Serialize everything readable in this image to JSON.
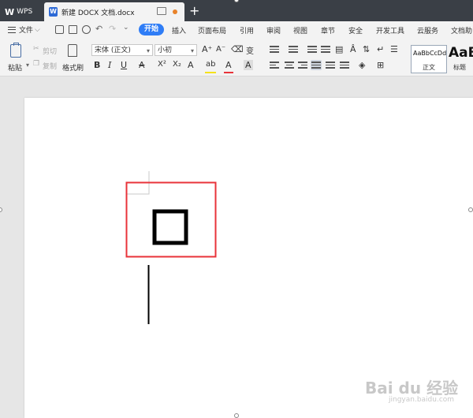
{
  "titlebar": {
    "app_tab_label": "WPS",
    "doc_tab_title": "新建 DOCX 文档.docx",
    "new_tab_symbol": "+"
  },
  "menubar": {
    "file_label": "文件",
    "active_tab": "开始",
    "items": [
      "插入",
      "页面布局",
      "引用",
      "审阅",
      "视图",
      "章节",
      "安全",
      "开发工具",
      "云服务",
      "文档助"
    ]
  },
  "ribbon": {
    "paste_label": "粘贴",
    "cut_label": "剪切",
    "copy_label": "复制",
    "format_painter_label": "格式刷",
    "font_name": "宋体 (正文)",
    "font_size": "小初",
    "style_normal_sample": "AaBbCcDd",
    "style_normal_label": "正文",
    "style_heading_sample": "AaB",
    "style_heading_label": "标题"
  },
  "colors": {
    "accent": "#2f7df6",
    "titlebar_bg": "#3a3f46",
    "selection_red": "#e8333a",
    "modified_dot": "#e8832a"
  },
  "watermark": {
    "text": "Bai du 经验",
    "sub": "jingyan.baidu.com"
  }
}
